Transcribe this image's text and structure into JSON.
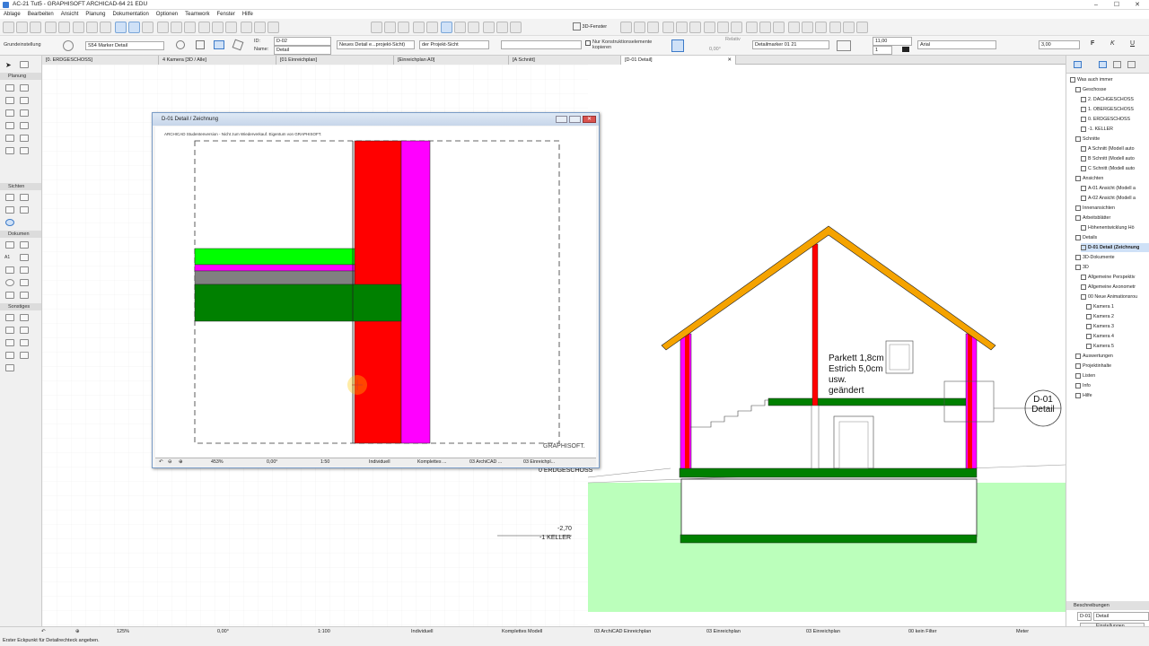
{
  "window": {
    "title": "AC-21 Tut5 - GRAPHISOFT ARCHICAD-64 21 EDU"
  },
  "menu": [
    "Ablage",
    "Bearbeiten",
    "Ansicht",
    "Planung",
    "Dokumentation",
    "Optionen",
    "Teamwork",
    "Fenster",
    "Hilfe"
  ],
  "toolbar": {
    "view3d_label": "3D-Fenster"
  },
  "infobox": {
    "layer_label": "Grundeinstellung",
    "marker": "S54 Marker Detail",
    "id_label": "ID:",
    "id_value": "D-02",
    "name_label": "Name:",
    "name_value": "Detail",
    "detail_type": "Neues Detail e...projekt-Sicht)",
    "project_view": "der Projekt-Sicht",
    "checkbox_label": "Nur Konstruktionselemente kopieren",
    "relativ_label": "Relativ",
    "angle": "0,00°",
    "marker_name": "Detailmarker 01 21",
    "size1": "11,00",
    "size2": "1",
    "font": "Arial",
    "size3": "3,00",
    "bold": "F",
    "italic": "K",
    "underline": "U"
  },
  "tabs": [
    "[0. ERDGESCHOSS]",
    "4 Kamera [3D / Alle]",
    "[01 Einreichplan]",
    "[Einreichplan A0]",
    "[A Schnitt]",
    "[D-01 Detail]"
  ],
  "toolbox": {
    "sections": [
      "Planung",
      "Sichten",
      "Dokumen",
      "Sonstiges"
    ],
    "arrow_label": "A1"
  },
  "detail_window": {
    "title": "D-01 Detail / Zeichnung",
    "watermark": "ARCHICAD Studentenversion - Nicht zum Wiederverkauf. Eigentum von GRAPHISOFT.",
    "brand": "GRAPHISOFT.",
    "footer": {
      "zoom": "453%",
      "angle": "0,00°",
      "scale": "1:50",
      "layer": "Individuell",
      "model": "Komplettes ...",
      "plan": "03 ArchiCAD ...",
      "einreich": "03 Einreichpl..."
    }
  },
  "section": {
    "level_label": "0 ERDGESCHOSS",
    "keller_value": "-2,70",
    "keller_label": "-1 KELLER",
    "note_lines": [
      "Parkett 1,8cm",
      "Estrich 5,0cm",
      "usw.",
      "geändert"
    ],
    "marker_id": "D-01",
    "marker_name": "Detail"
  },
  "navigator": {
    "root": "Was auch immer",
    "items": [
      {
        "label": "Geschosse",
        "level": 1
      },
      {
        "label": "2. DACHGESCHOSS",
        "level": 2
      },
      {
        "label": "1. OBERGESCHOSS",
        "level": 2
      },
      {
        "label": "0. ERDGESCHOSS",
        "level": 2
      },
      {
        "label": "-1. KELLER",
        "level": 2
      },
      {
        "label": "Schnitte",
        "level": 1
      },
      {
        "label": "A Schnitt (Modell auto",
        "level": 2
      },
      {
        "label": "B Schnitt (Modell auto",
        "level": 2
      },
      {
        "label": "C Schnitt (Modell auto",
        "level": 2
      },
      {
        "label": "Ansichten",
        "level": 1
      },
      {
        "label": "A-01 Ansicht (Modell a",
        "level": 2
      },
      {
        "label": "A-02 Ansicht (Modell a",
        "level": 2
      },
      {
        "label": "Innenansichten",
        "level": 1
      },
      {
        "label": "Arbeitsblätter",
        "level": 1
      },
      {
        "label": "Höhenentwicklung Hö",
        "level": 2
      },
      {
        "label": "Details",
        "level": 1
      },
      {
        "label": "D-01 Detail (Zeichnung",
        "level": 2
      },
      {
        "label": "3D-Dokumente",
        "level": 1
      },
      {
        "label": "3D",
        "level": 1
      },
      {
        "label": "Allgemeine Perspektiv",
        "level": 2
      },
      {
        "label": "Allgemeine Axonometr",
        "level": 2
      },
      {
        "label": "00 Neue Animationsrou",
        "level": 2
      },
      {
        "label": "Kamera 1",
        "level": 3
      },
      {
        "label": "Kamera 2",
        "level": 3
      },
      {
        "label": "Kamera 3",
        "level": 3
      },
      {
        "label": "Kamera 4",
        "level": 3
      },
      {
        "label": "Kamera 5",
        "level": 3
      },
      {
        "label": "Auswertungen",
        "level": 1
      },
      {
        "label": "Projektinhalte",
        "level": 1
      },
      {
        "label": "Listen",
        "level": 1
      },
      {
        "label": "Info",
        "level": 1
      },
      {
        "label": "Hilfe",
        "level": 1
      }
    ],
    "props_header": "Beschreibungen",
    "props_id": "D-01",
    "props_name": "Detail",
    "settings_button": "Einstellungen..."
  },
  "statusbar": {
    "zoom": "125%",
    "angle": "0,00°",
    "scale": "1:100",
    "layer": "Individuell",
    "model": "Komplettes Modell",
    "plan": "03 ArchiCAD Einreichplan",
    "einreich": "03 Einreichplan",
    "dim": "03 Einreichplan",
    "filter": "00 kein Filter",
    "unit": "Meter",
    "hint": "Erster Eckpunkt für Detailrechteck angeben."
  },
  "colors": {
    "red": "#ff0000",
    "magenta": "#ff00ff",
    "green": "#008000",
    "lime": "#00ff00",
    "roof": "#f5a300",
    "ground": "#bbffbb"
  }
}
